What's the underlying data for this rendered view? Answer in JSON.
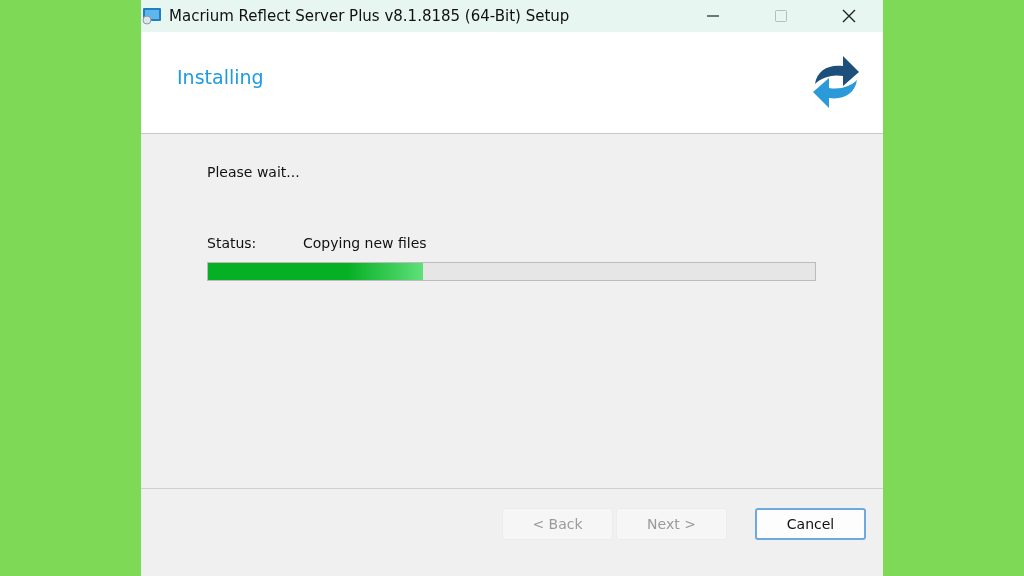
{
  "window": {
    "title": "Macrium Reflect Server Plus v8.1.8185 (64-Bit) Setup",
    "controls": [
      {
        "kind": "minimize",
        "disabled": false
      },
      {
        "kind": "maximize",
        "disabled": true
      },
      {
        "kind": "close",
        "disabled": false
      }
    ]
  },
  "header": {
    "title": "Installing"
  },
  "body": {
    "message": "Please wait...",
    "status_label": "Status:",
    "status_value": "Copying new files",
    "progress": {
      "level": 0.355
    }
  },
  "buttons": [
    {
      "label": "< Back",
      "disabled": true,
      "focused": false
    },
    {
      "label": "Next >",
      "disabled": true,
      "focused": false
    },
    {
      "label": "Cancel",
      "disabled": false,
      "focused": true
    }
  ]
}
